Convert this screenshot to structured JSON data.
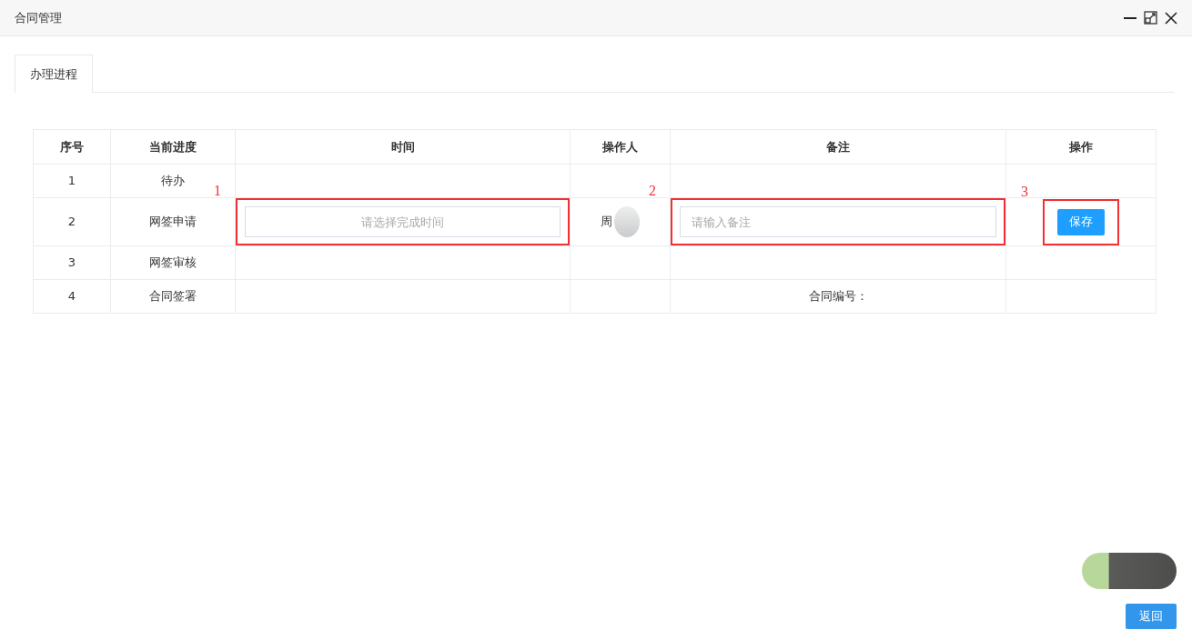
{
  "window": {
    "title": "合同管理"
  },
  "tabs": [
    {
      "label": "办理进程",
      "selected": true
    }
  ],
  "table": {
    "columns": [
      "序号",
      "当前进度",
      "时间",
      "操作人",
      "备注",
      "操作"
    ],
    "rows": [
      {
        "number": "1",
        "stage": "待办"
      },
      {
        "number": "2",
        "stage": "网签申请",
        "time_field": {
          "placeholder": "请选择完成时间",
          "annotation": "1"
        },
        "operator": "周",
        "operator_redacted": true,
        "remark_field": {
          "placeholder": "请输入备注",
          "annotation": "2"
        },
        "action": {
          "label": "保存",
          "annotation": "3"
        }
      },
      {
        "number": "3",
        "stage": "网签审核"
      },
      {
        "number": "4",
        "stage": "合同签署",
        "remark": "合同编号："
      }
    ]
  },
  "footer": {
    "button": "返回",
    "redacted": true
  }
}
